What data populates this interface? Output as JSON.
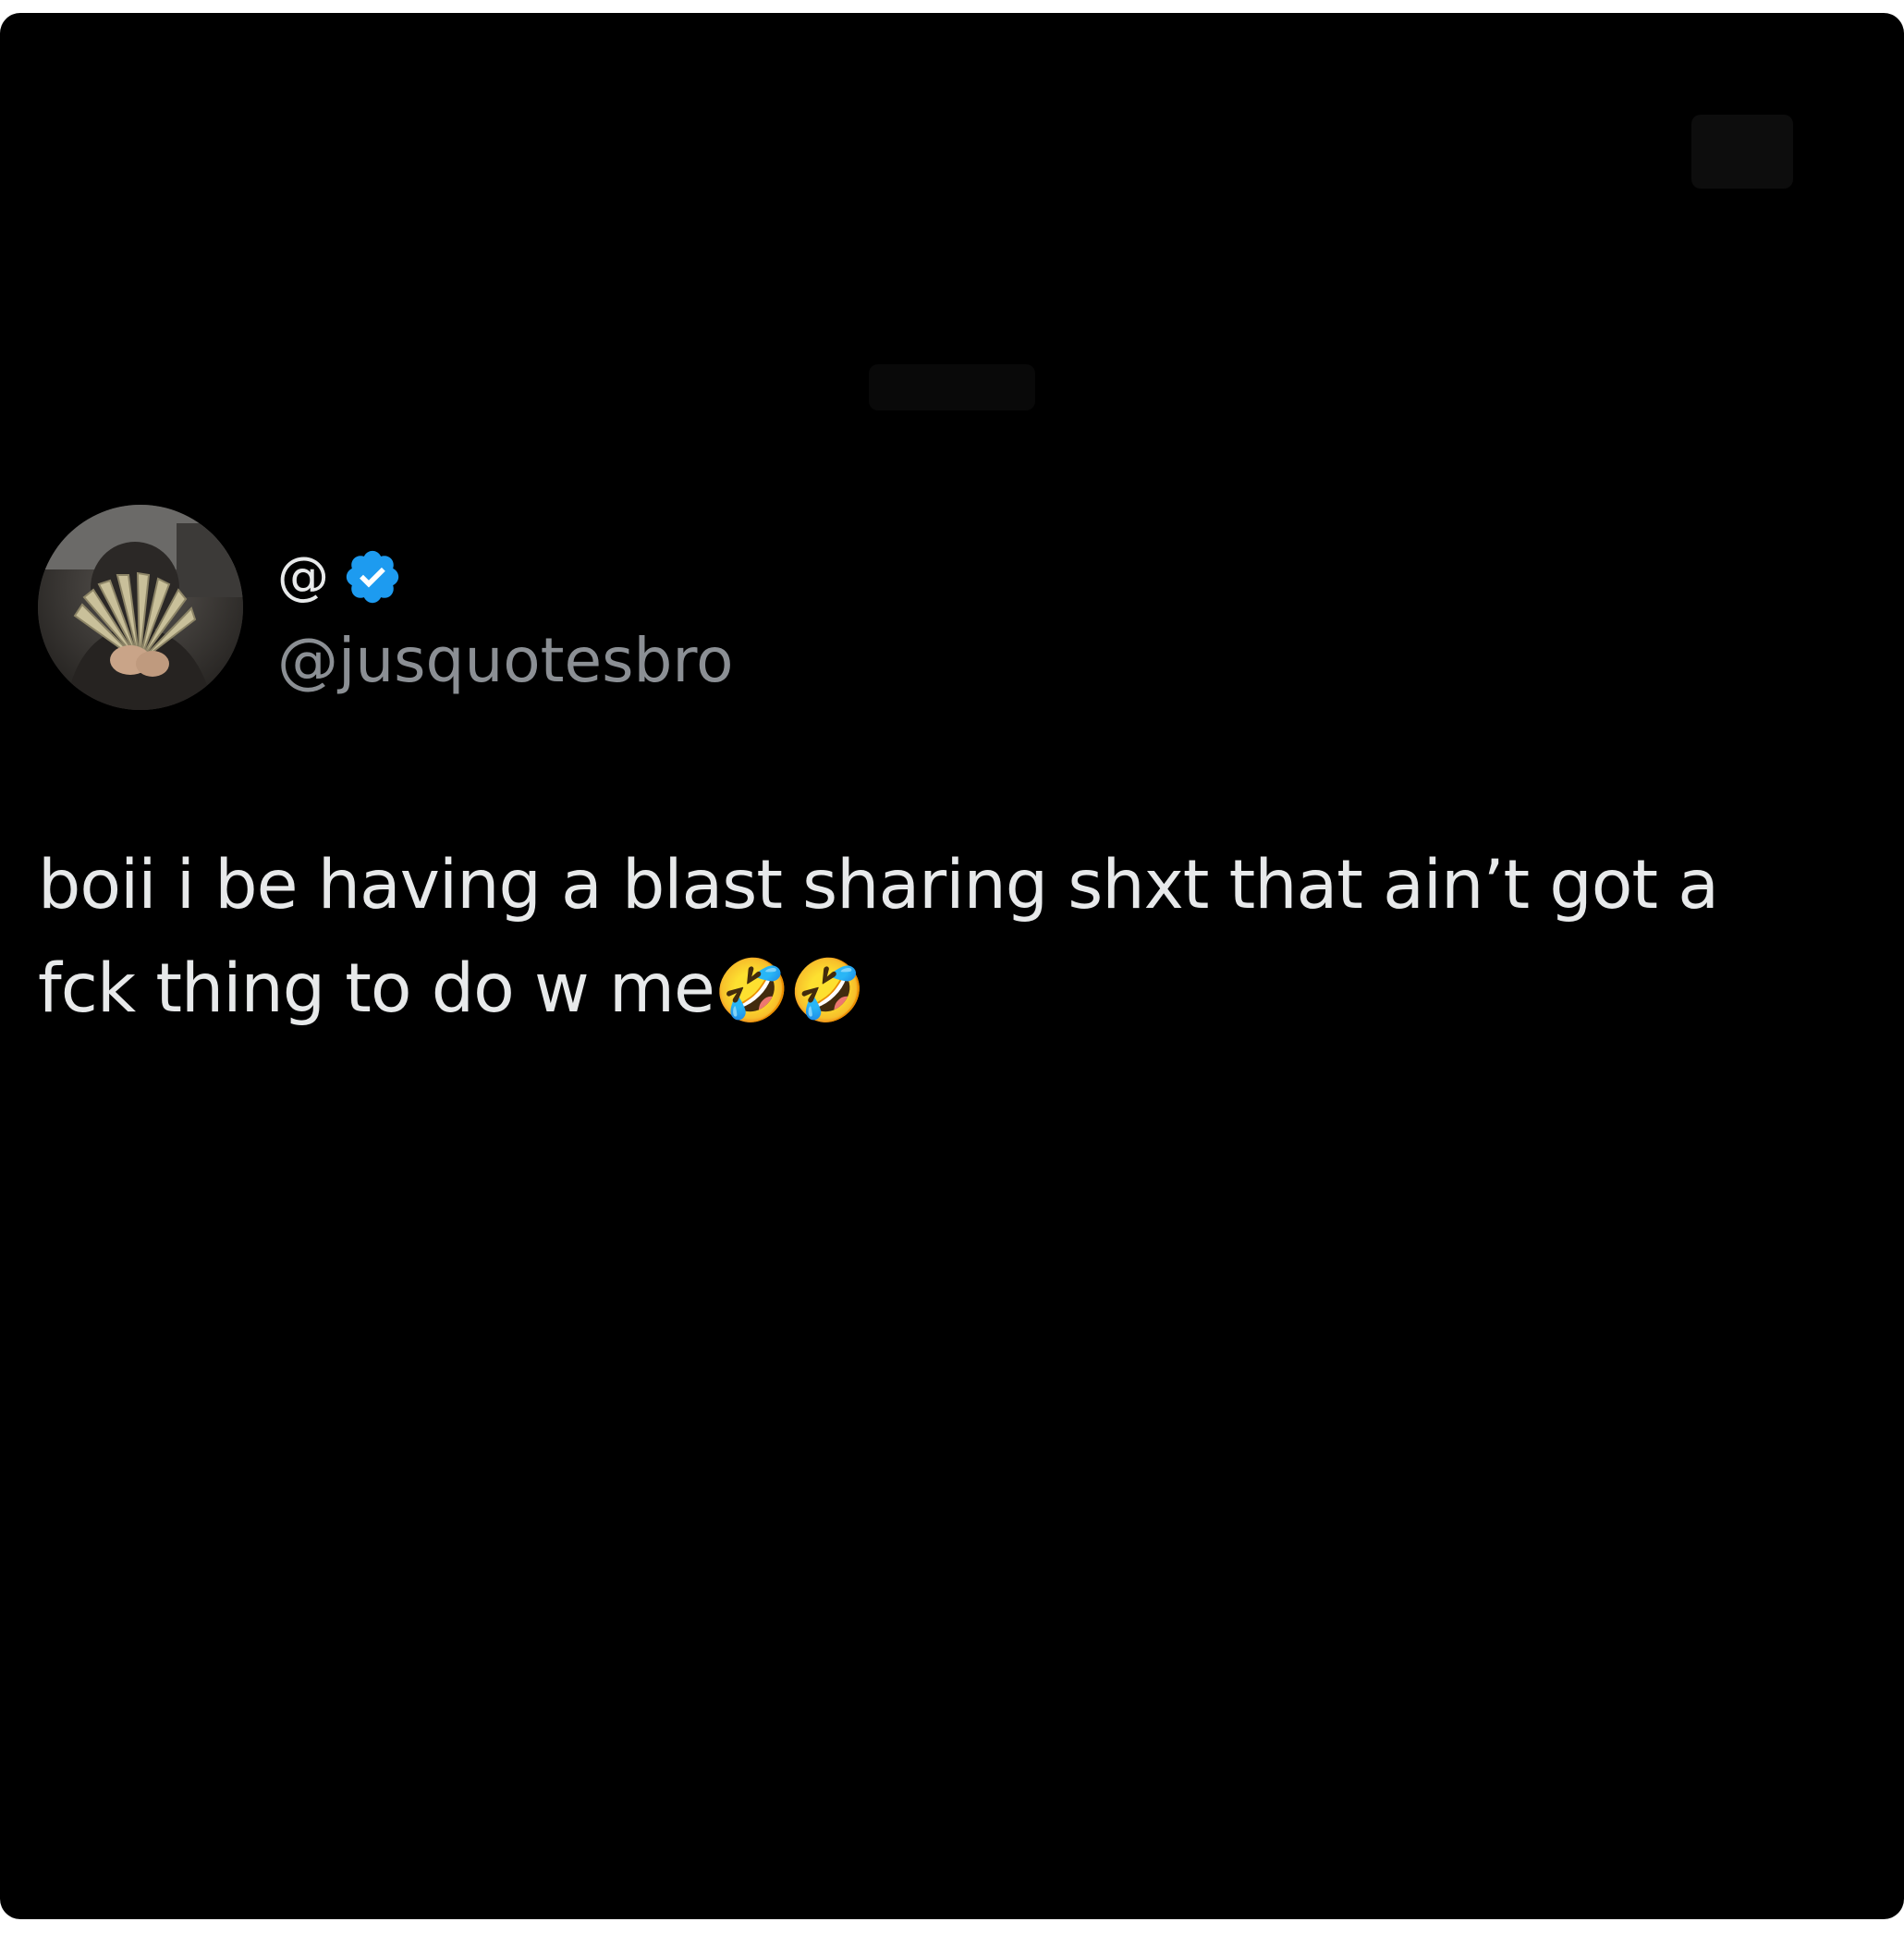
{
  "tweet": {
    "display_name": "@",
    "handle": "@jusquotesbro",
    "text": "boii i be having a blast sharing shxt that ain’t got a fck thing to do w me",
    "emojis": "🤣🤣",
    "verified": true
  },
  "colors": {
    "background": "#000000",
    "text_primary": "#e7e9ea",
    "text_secondary": "#8b8f94",
    "verified_badge": "#1d9bf0"
  },
  "icons": {
    "verified": "verified-badge-icon",
    "avatar": "profile-avatar"
  }
}
